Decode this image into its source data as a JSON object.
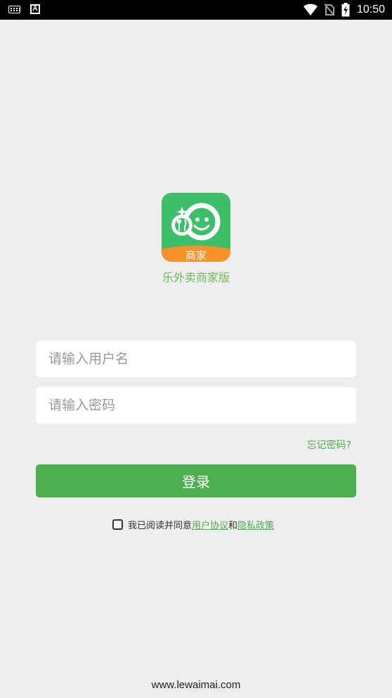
{
  "status_bar": {
    "time": "10:50",
    "left_icons": [
      "keyboard-icon",
      "a-badge-icon"
    ],
    "right_icons": [
      "wifi-icon",
      "no-sim-icon",
      "battery-charging-icon"
    ],
    "a_glyph": "A"
  },
  "app": {
    "logo_badge": "商家",
    "name": "乐外卖商家版",
    "brand_color": "#4caf50",
    "logo_bg": "#3dbf6a",
    "logo_accent": "#f7922a"
  },
  "form": {
    "username_placeholder": "请输入用户名",
    "username_value": "",
    "password_placeholder": "请输入密码",
    "password_value": "",
    "forgot_label": "忘记密码?",
    "login_label": "登录"
  },
  "agreement": {
    "checked": false,
    "prefix": "我已阅读并同意",
    "user_agreement": "用户协议",
    "conjunction": "和",
    "privacy_policy": "隐私政策"
  },
  "footer": {
    "url": "www.lewaimai.com"
  }
}
